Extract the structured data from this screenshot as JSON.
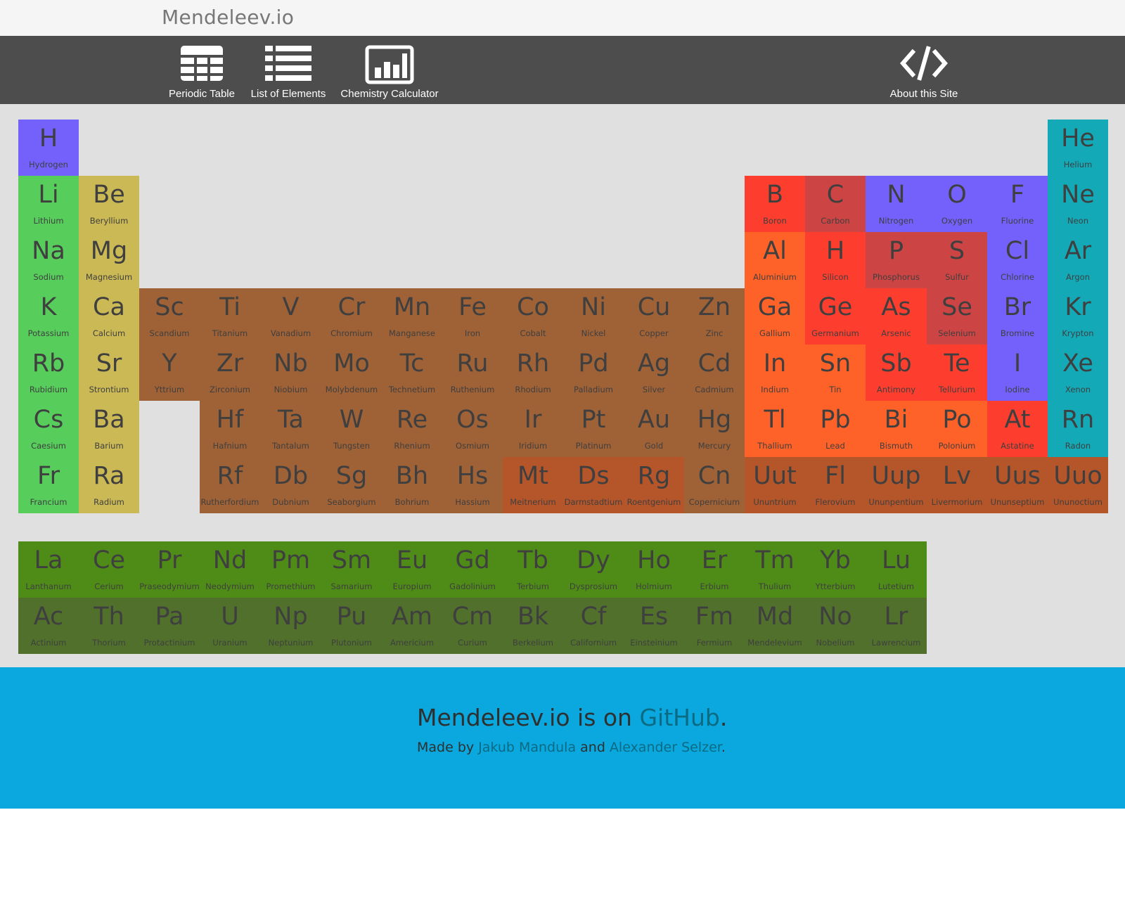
{
  "brand": "Mendeleev.io",
  "nav": {
    "periodic_table": "Periodic Table",
    "list_of_elements": "List of Elements",
    "chemistry_calculator": "Chemistry Calculator",
    "about": "About this Site"
  },
  "colors": {
    "nonmetal": "#7461fb",
    "noble": "#13a9b7",
    "alkali": "#57cd5c",
    "alkaline": "#cbb955",
    "transition": "#9f6136",
    "metalloid": "#fd3e2f",
    "nonmetal_red": "#cc4444",
    "post_transition": "#ff6228",
    "unknown": "#b5552a",
    "lanthanide": "#4f8c17",
    "actinide": "#50702b"
  },
  "elements": [
    {
      "sym": "H",
      "name": "Hydrogen",
      "col": 1,
      "row": 1,
      "cat": "nonmetal"
    },
    {
      "sym": "He",
      "name": "Helium",
      "col": 18,
      "row": 1,
      "cat": "noble"
    },
    {
      "sym": "Li",
      "name": "Lithium",
      "col": 1,
      "row": 2,
      "cat": "alkali"
    },
    {
      "sym": "Be",
      "name": "Beryllium",
      "col": 2,
      "row": 2,
      "cat": "alkaline"
    },
    {
      "sym": "B",
      "name": "Boron",
      "col": 13,
      "row": 2,
      "cat": "metalloid"
    },
    {
      "sym": "C",
      "name": "Carbon",
      "col": 14,
      "row": 2,
      "cat": "nonmetal_red"
    },
    {
      "sym": "N",
      "name": "Nitrogen",
      "col": 15,
      "row": 2,
      "cat": "nonmetal"
    },
    {
      "sym": "O",
      "name": "Oxygen",
      "col": 16,
      "row": 2,
      "cat": "nonmetal"
    },
    {
      "sym": "F",
      "name": "Fluorine",
      "col": 17,
      "row": 2,
      "cat": "nonmetal"
    },
    {
      "sym": "Ne",
      "name": "Neon",
      "col": 18,
      "row": 2,
      "cat": "noble"
    },
    {
      "sym": "Na",
      "name": "Sodium",
      "col": 1,
      "row": 3,
      "cat": "alkali"
    },
    {
      "sym": "Mg",
      "name": "Magnesium",
      "col": 2,
      "row": 3,
      "cat": "alkaline"
    },
    {
      "sym": "Al",
      "name": "Aluminium",
      "col": 13,
      "row": 3,
      "cat": "post_transition"
    },
    {
      "sym": "H",
      "name": "Silicon",
      "col": 14,
      "row": 3,
      "cat": "metalloid"
    },
    {
      "sym": "P",
      "name": "Phosphorus",
      "col": 15,
      "row": 3,
      "cat": "nonmetal_red"
    },
    {
      "sym": "S",
      "name": "Sulfur",
      "col": 16,
      "row": 3,
      "cat": "nonmetal_red"
    },
    {
      "sym": "Cl",
      "name": "Chlorine",
      "col": 17,
      "row": 3,
      "cat": "nonmetal"
    },
    {
      "sym": "Ar",
      "name": "Argon",
      "col": 18,
      "row": 3,
      "cat": "noble"
    },
    {
      "sym": "K",
      "name": "Potassium",
      "col": 1,
      "row": 4,
      "cat": "alkali"
    },
    {
      "sym": "Ca",
      "name": "Calcium",
      "col": 2,
      "row": 4,
      "cat": "alkaline"
    },
    {
      "sym": "Sc",
      "name": "Scandium",
      "col": 3,
      "row": 4,
      "cat": "transition"
    },
    {
      "sym": "Ti",
      "name": "Titanium",
      "col": 4,
      "row": 4,
      "cat": "transition"
    },
    {
      "sym": "V",
      "name": "Vanadium",
      "col": 5,
      "row": 4,
      "cat": "transition"
    },
    {
      "sym": "Cr",
      "name": "Chromium",
      "col": 6,
      "row": 4,
      "cat": "transition"
    },
    {
      "sym": "Mn",
      "name": "Manganese",
      "col": 7,
      "row": 4,
      "cat": "transition"
    },
    {
      "sym": "Fe",
      "name": "Iron",
      "col": 8,
      "row": 4,
      "cat": "transition"
    },
    {
      "sym": "Co",
      "name": "Cobalt",
      "col": 9,
      "row": 4,
      "cat": "transition"
    },
    {
      "sym": "Ni",
      "name": "Nickel",
      "col": 10,
      "row": 4,
      "cat": "transition"
    },
    {
      "sym": "Cu",
      "name": "Copper",
      "col": 11,
      "row": 4,
      "cat": "transition"
    },
    {
      "sym": "Zn",
      "name": "Zinc",
      "col": 12,
      "row": 4,
      "cat": "transition"
    },
    {
      "sym": "Ga",
      "name": "Gallium",
      "col": 13,
      "row": 4,
      "cat": "post_transition"
    },
    {
      "sym": "Ge",
      "name": "Germanium",
      "col": 14,
      "row": 4,
      "cat": "metalloid"
    },
    {
      "sym": "As",
      "name": "Arsenic",
      "col": 15,
      "row": 4,
      "cat": "metalloid"
    },
    {
      "sym": "Se",
      "name": "Selenium",
      "col": 16,
      "row": 4,
      "cat": "nonmetal_red"
    },
    {
      "sym": "Br",
      "name": "Bromine",
      "col": 17,
      "row": 4,
      "cat": "nonmetal"
    },
    {
      "sym": "Kr",
      "name": "Krypton",
      "col": 18,
      "row": 4,
      "cat": "noble"
    },
    {
      "sym": "Rb",
      "name": "Rubidium",
      "col": 1,
      "row": 5,
      "cat": "alkali"
    },
    {
      "sym": "Sr",
      "name": "Strontium",
      "col": 2,
      "row": 5,
      "cat": "alkaline"
    },
    {
      "sym": "Y",
      "name": "Yttrium",
      "col": 3,
      "row": 5,
      "cat": "transition"
    },
    {
      "sym": "Zr",
      "name": "Zirconium",
      "col": 4,
      "row": 5,
      "cat": "transition"
    },
    {
      "sym": "Nb",
      "name": "Niobium",
      "col": 5,
      "row": 5,
      "cat": "transition"
    },
    {
      "sym": "Mo",
      "name": "Molybdenum",
      "col": 6,
      "row": 5,
      "cat": "transition"
    },
    {
      "sym": "Tc",
      "name": "Technetium",
      "col": 7,
      "row": 5,
      "cat": "transition"
    },
    {
      "sym": "Ru",
      "name": "Ruthenium",
      "col": 8,
      "row": 5,
      "cat": "transition"
    },
    {
      "sym": "Rh",
      "name": "Rhodium",
      "col": 9,
      "row": 5,
      "cat": "transition"
    },
    {
      "sym": "Pd",
      "name": "Palladium",
      "col": 10,
      "row": 5,
      "cat": "transition"
    },
    {
      "sym": "Ag",
      "name": "Silver",
      "col": 11,
      "row": 5,
      "cat": "transition"
    },
    {
      "sym": "Cd",
      "name": "Cadmium",
      "col": 12,
      "row": 5,
      "cat": "transition"
    },
    {
      "sym": "In",
      "name": "Indium",
      "col": 13,
      "row": 5,
      "cat": "post_transition"
    },
    {
      "sym": "Sn",
      "name": "Tin",
      "col": 14,
      "row": 5,
      "cat": "post_transition"
    },
    {
      "sym": "Sb",
      "name": "Antimony",
      "col": 15,
      "row": 5,
      "cat": "metalloid"
    },
    {
      "sym": "Te",
      "name": "Tellurium",
      "col": 16,
      "row": 5,
      "cat": "metalloid"
    },
    {
      "sym": "I",
      "name": "Iodine",
      "col": 17,
      "row": 5,
      "cat": "nonmetal"
    },
    {
      "sym": "Xe",
      "name": "Xenon",
      "col": 18,
      "row": 5,
      "cat": "noble"
    },
    {
      "sym": "Cs",
      "name": "Caesium",
      "col": 1,
      "row": 6,
      "cat": "alkali"
    },
    {
      "sym": "Ba",
      "name": "Barium",
      "col": 2,
      "row": 6,
      "cat": "alkaline"
    },
    {
      "sym": "Hf",
      "name": "Hafnium",
      "col": 4,
      "row": 6,
      "cat": "transition"
    },
    {
      "sym": "Ta",
      "name": "Tantalum",
      "col": 5,
      "row": 6,
      "cat": "transition"
    },
    {
      "sym": "W",
      "name": "Tungsten",
      "col": 6,
      "row": 6,
      "cat": "transition"
    },
    {
      "sym": "Re",
      "name": "Rhenium",
      "col": 7,
      "row": 6,
      "cat": "transition"
    },
    {
      "sym": "Os",
      "name": "Osmium",
      "col": 8,
      "row": 6,
      "cat": "transition"
    },
    {
      "sym": "Ir",
      "name": "Iridium",
      "col": 9,
      "row": 6,
      "cat": "transition"
    },
    {
      "sym": "Pt",
      "name": "Platinum",
      "col": 10,
      "row": 6,
      "cat": "transition"
    },
    {
      "sym": "Au",
      "name": "Gold",
      "col": 11,
      "row": 6,
      "cat": "transition"
    },
    {
      "sym": "Hg",
      "name": "Mercury",
      "col": 12,
      "row": 6,
      "cat": "transition"
    },
    {
      "sym": "Tl",
      "name": "Thallium",
      "col": 13,
      "row": 6,
      "cat": "post_transition"
    },
    {
      "sym": "Pb",
      "name": "Lead",
      "col": 14,
      "row": 6,
      "cat": "post_transition"
    },
    {
      "sym": "Bi",
      "name": "Bismuth",
      "col": 15,
      "row": 6,
      "cat": "post_transition"
    },
    {
      "sym": "Po",
      "name": "Polonium",
      "col": 16,
      "row": 6,
      "cat": "post_transition"
    },
    {
      "sym": "At",
      "name": "Astatine",
      "col": 17,
      "row": 6,
      "cat": "metalloid"
    },
    {
      "sym": "Rn",
      "name": "Radon",
      "col": 18,
      "row": 6,
      "cat": "noble"
    },
    {
      "sym": "Fr",
      "name": "Francium",
      "col": 1,
      "row": 7,
      "cat": "alkali"
    },
    {
      "sym": "Ra",
      "name": "Radium",
      "col": 2,
      "row": 7,
      "cat": "alkaline"
    },
    {
      "sym": "Rf",
      "name": "Rutherfordium",
      "col": 4,
      "row": 7,
      "cat": "transition"
    },
    {
      "sym": "Db",
      "name": "Dubnium",
      "col": 5,
      "row": 7,
      "cat": "transition"
    },
    {
      "sym": "Sg",
      "name": "Seaborgium",
      "col": 6,
      "row": 7,
      "cat": "transition"
    },
    {
      "sym": "Bh",
      "name": "Bohrium",
      "col": 7,
      "row": 7,
      "cat": "transition"
    },
    {
      "sym": "Hs",
      "name": "Hassium",
      "col": 8,
      "row": 7,
      "cat": "transition"
    },
    {
      "sym": "Mt",
      "name": "Meitnerium",
      "col": 9,
      "row": 7,
      "cat": "unknown"
    },
    {
      "sym": "Ds",
      "name": "Darmstadtium",
      "col": 10,
      "row": 7,
      "cat": "unknown"
    },
    {
      "sym": "Rg",
      "name": "Roentgenium",
      "col": 11,
      "row": 7,
      "cat": "unknown"
    },
    {
      "sym": "Cn",
      "name": "Copernicium",
      "col": 12,
      "row": 7,
      "cat": "transition"
    },
    {
      "sym": "Uut",
      "name": "Ununtrium",
      "col": 13,
      "row": 7,
      "cat": "unknown"
    },
    {
      "sym": "Fl",
      "name": "Flerovium",
      "col": 14,
      "row": 7,
      "cat": "unknown"
    },
    {
      "sym": "Uup",
      "name": "Ununpentium",
      "col": 15,
      "row": 7,
      "cat": "unknown"
    },
    {
      "sym": "Lv",
      "name": "Livermorium",
      "col": 16,
      "row": 7,
      "cat": "unknown"
    },
    {
      "sym": "Uus",
      "name": "Ununseptium",
      "col": 17,
      "row": 7,
      "cat": "unknown"
    },
    {
      "sym": "Uuo",
      "name": "Ununoctium",
      "col": 18,
      "row": 7,
      "cat": "unknown"
    },
    {
      "sym": "La",
      "name": "Lanthanum",
      "col": 1,
      "row": 9,
      "cat": "lanthanide"
    },
    {
      "sym": "Ce",
      "name": "Cerium",
      "col": 2,
      "row": 9,
      "cat": "lanthanide"
    },
    {
      "sym": "Pr",
      "name": "Praseodymium",
      "col": 3,
      "row": 9,
      "cat": "lanthanide"
    },
    {
      "sym": "Nd",
      "name": "Neodymium",
      "col": 4,
      "row": 9,
      "cat": "lanthanide"
    },
    {
      "sym": "Pm",
      "name": "Promethium",
      "col": 5,
      "row": 9,
      "cat": "lanthanide"
    },
    {
      "sym": "Sm",
      "name": "Samarium",
      "col": 6,
      "row": 9,
      "cat": "lanthanide"
    },
    {
      "sym": "Eu",
      "name": "Europium",
      "col": 7,
      "row": 9,
      "cat": "lanthanide"
    },
    {
      "sym": "Gd",
      "name": "Gadolinium",
      "col": 8,
      "row": 9,
      "cat": "lanthanide"
    },
    {
      "sym": "Tb",
      "name": "Terbium",
      "col": 9,
      "row": 9,
      "cat": "lanthanide"
    },
    {
      "sym": "Dy",
      "name": "Dysprosium",
      "col": 10,
      "row": 9,
      "cat": "lanthanide"
    },
    {
      "sym": "Ho",
      "name": "Holmium",
      "col": 11,
      "row": 9,
      "cat": "lanthanide"
    },
    {
      "sym": "Er",
      "name": "Erbium",
      "col": 12,
      "row": 9,
      "cat": "lanthanide"
    },
    {
      "sym": "Tm",
      "name": "Thulium",
      "col": 13,
      "row": 9,
      "cat": "lanthanide"
    },
    {
      "sym": "Yb",
      "name": "Ytterbium",
      "col": 14,
      "row": 9,
      "cat": "lanthanide"
    },
    {
      "sym": "Lu",
      "name": "Lutetium",
      "col": 15,
      "row": 9,
      "cat": "lanthanide"
    },
    {
      "sym": "Ac",
      "name": "Actinium",
      "col": 1,
      "row": 10,
      "cat": "actinide"
    },
    {
      "sym": "Th",
      "name": "Thorium",
      "col": 2,
      "row": 10,
      "cat": "actinide"
    },
    {
      "sym": "Pa",
      "name": "Protactinium",
      "col": 3,
      "row": 10,
      "cat": "actinide"
    },
    {
      "sym": "U",
      "name": "Uranium",
      "col": 4,
      "row": 10,
      "cat": "actinide"
    },
    {
      "sym": "Np",
      "name": "Neptunium",
      "col": 5,
      "row": 10,
      "cat": "actinide"
    },
    {
      "sym": "Pu",
      "name": "Plutonium",
      "col": 6,
      "row": 10,
      "cat": "actinide"
    },
    {
      "sym": "Am",
      "name": "Americium",
      "col": 7,
      "row": 10,
      "cat": "actinide"
    },
    {
      "sym": "Cm",
      "name": "Curium",
      "col": 8,
      "row": 10,
      "cat": "actinide"
    },
    {
      "sym": "Bk",
      "name": "Berkelium",
      "col": 9,
      "row": 10,
      "cat": "actinide"
    },
    {
      "sym": "Cf",
      "name": "Californium",
      "col": 10,
      "row": 10,
      "cat": "actinide"
    },
    {
      "sym": "Es",
      "name": "Einsteinium",
      "col": 11,
      "row": 10,
      "cat": "actinide"
    },
    {
      "sym": "Fm",
      "name": "Fermium",
      "col": 12,
      "row": 10,
      "cat": "actinide"
    },
    {
      "sym": "Md",
      "name": "Mendelevium",
      "col": 13,
      "row": 10,
      "cat": "actinide"
    },
    {
      "sym": "No",
      "name": "Nobelium",
      "col": 14,
      "row": 10,
      "cat": "actinide"
    },
    {
      "sym": "Lr",
      "name": "Lawrencium",
      "col": 15,
      "row": 10,
      "cat": "actinide"
    }
  ],
  "footer": {
    "line1_prefix": "Mendeleev.io is on ",
    "github": "GitHub",
    "line1_suffix": ".",
    "line2_prefix": "Made by ",
    "author1": "Jakub Mandula",
    "line2_and": " and ",
    "author2": "Alexander Selzer",
    "line2_suffix": "."
  }
}
